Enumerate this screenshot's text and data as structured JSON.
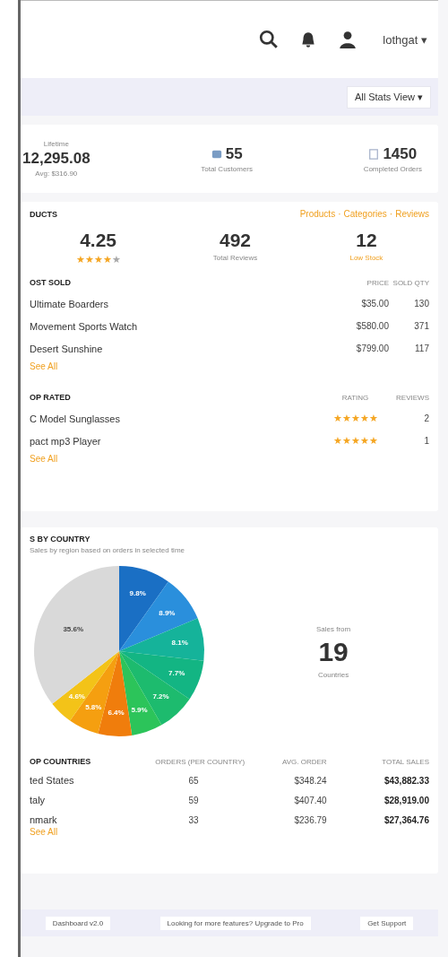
{
  "header": {
    "user_menu": "lothgat ▾"
  },
  "toolbar": {
    "view_button": "All Stats View ▾"
  },
  "summary": [
    {
      "kind": "money",
      "label": "Lifetime",
      "value": "12,295.08",
      "sub": "Avg: $316.90"
    },
    {
      "kind": "customers",
      "value": "55",
      "sub": "Total Customers"
    },
    {
      "kind": "orders",
      "value": "1450",
      "sub": "Completed Orders"
    }
  ],
  "products": {
    "title": "DUCTS",
    "links": [
      "Products",
      "Categories",
      "Reviews"
    ],
    "separator": "·",
    "stats": [
      {
        "kind": "rating",
        "value": "4.25",
        "stars": 4
      },
      {
        "kind": "plain",
        "value": "492",
        "sub": "Total Reviews"
      },
      {
        "kind": "warning",
        "value": "12",
        "sub": "Low Stock"
      }
    ],
    "most_sold": {
      "title": "OST SOLD",
      "columns": [
        "PRICE",
        "SOLD QTY"
      ],
      "rows": [
        {
          "name": "Ultimate Boarders",
          "price": "$35.00",
          "qty": "130"
        },
        {
          "name": "Movement Sports Watch",
          "price": "$580.00",
          "qty": "371"
        },
        {
          "name": "Desert Sunshine",
          "price": "$799.00",
          "qty": "117"
        }
      ],
      "link": "See All"
    },
    "top_rated": {
      "title": "OP RATED",
      "columns": [
        "RATING",
        "REVIEWS"
      ],
      "rows": [
        {
          "name": "C Model Sunglasses",
          "stars": 5,
          "reviews": "2"
        },
        {
          "name": "pact mp3 Player",
          "stars": 5,
          "reviews": "1"
        }
      ],
      "link": "See All"
    }
  },
  "countries": {
    "title": "S BY COUNTRY",
    "subtitle": "Sales by region based on orders in selected time",
    "chart_data": {
      "type": "pie",
      "values": [
        9.8,
        8.9,
        8.1,
        7.7,
        7.2,
        5.9,
        6.4,
        5.8,
        4.6,
        35.6
      ],
      "value_labels": [
        "9.8%",
        "8.9%",
        "8.1%",
        "7.7%",
        "7.2%",
        "5.9%",
        "6.4%",
        "5.8%",
        "4.6%",
        "35.6%"
      ]
    },
    "total_label": "Sales from",
    "total": "19",
    "total_sub": "Countries",
    "columns": [
      "OP COUNTRIES",
      "ORDERS (PER COUNTRY)",
      "AVG. ORDER",
      "TOTAL SALES"
    ],
    "rows": [
      [
        "ted States",
        "65",
        "$348.24",
        "$43,882.33"
      ],
      [
        "taly",
        "59",
        "$407.40",
        "$28,919.00"
      ],
      [
        "nmark",
        "33",
        "$236.79",
        "$27,364.76"
      ]
    ],
    "link": "See All"
  },
  "footer": [
    "Dashboard v2.0",
    "Looking for more features? Upgrade to Pro",
    "Get Support"
  ]
}
